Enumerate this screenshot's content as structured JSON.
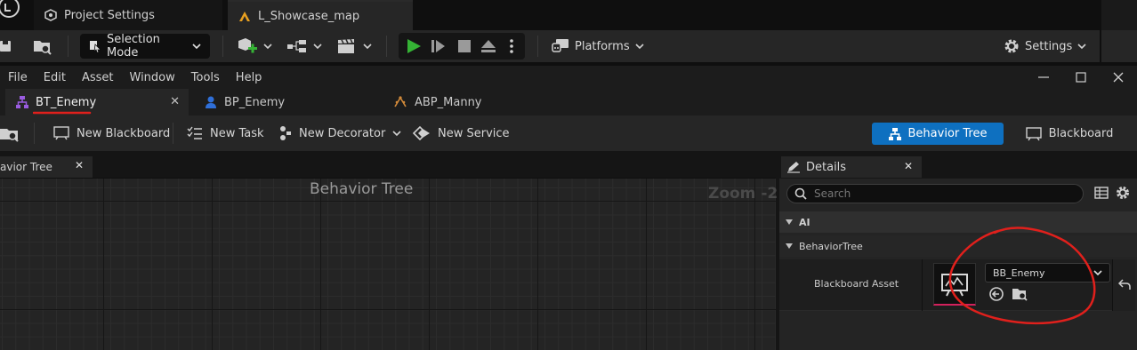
{
  "top_tabs": {
    "project_settings": "Project Settings",
    "map": "L_Showcase_map"
  },
  "main_toolbar": {
    "selection_mode": "Selection Mode",
    "platforms": "Platforms",
    "settings": "Settings"
  },
  "menu": [
    "File",
    "Edit",
    "Asset",
    "Window",
    "Tools",
    "Help"
  ],
  "window_controls": {
    "minimize": "—",
    "maximize": "☐",
    "close": "✕"
  },
  "asset_tabs": [
    {
      "label": "BT_Enemy",
      "active": true
    },
    {
      "label": "BP_Enemy",
      "active": false
    },
    {
      "label": "ABP_Manny",
      "active": false
    }
  ],
  "asset_toolbar": {
    "new_blackboard": "New Blackboard",
    "new_task": "New Task",
    "new_decorator": "New Decorator",
    "new_service": "New Service",
    "mode_behavior_tree": "Behavior Tree",
    "mode_blackboard": "Blackboard"
  },
  "graph": {
    "tab_label": "avior Tree",
    "title": "Behavior Tree",
    "zoom": "Zoom -2"
  },
  "details": {
    "tab_label": "Details",
    "search_placeholder": "Search",
    "categories": [
      "AI",
      "BehaviorTree"
    ],
    "property_name": "Blackboard Asset",
    "property_value": "BB_Enemy"
  },
  "colors": {
    "accent_blue": "#0e70c0",
    "play_green": "#35b335",
    "annotation_red": "#e0201c",
    "asset_underline": "#d2215c"
  }
}
